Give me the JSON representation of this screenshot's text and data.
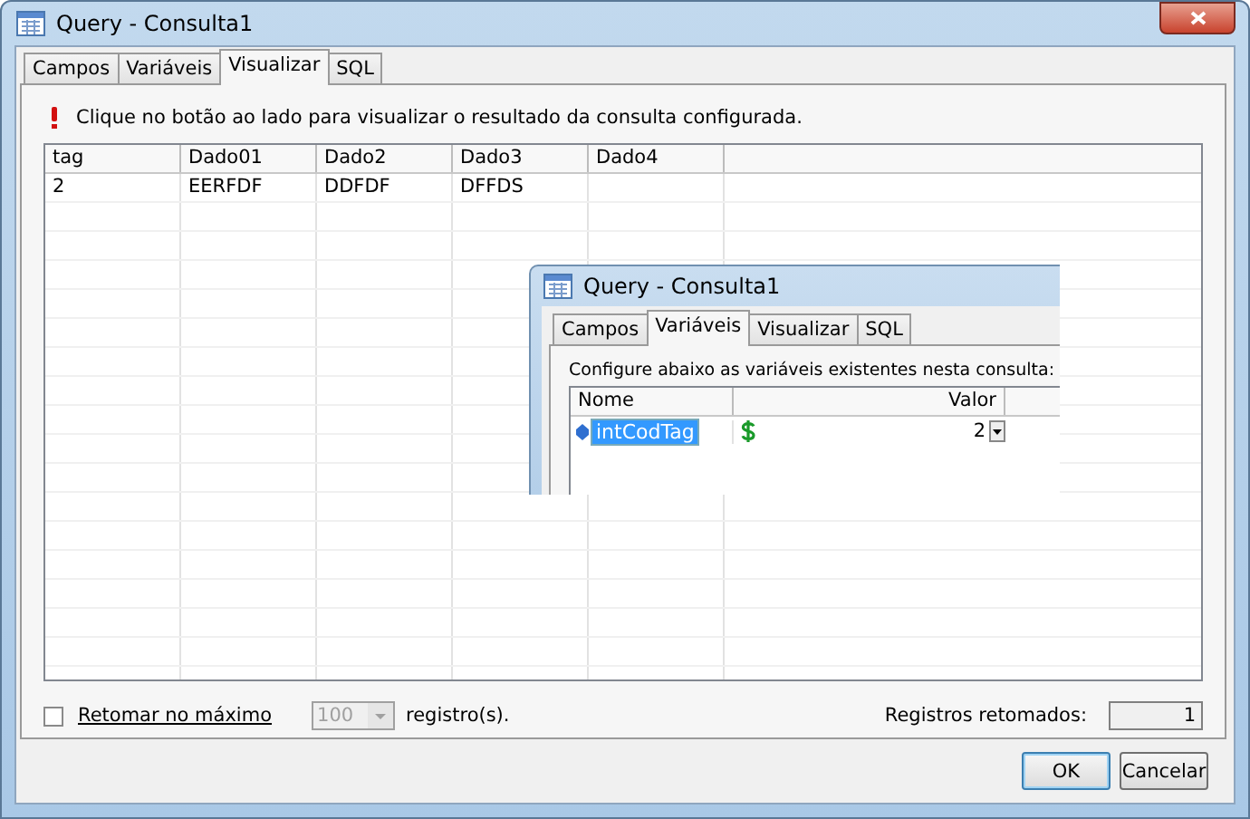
{
  "window": {
    "title": "Query - Consulta1"
  },
  "tabs": [
    {
      "label": "Campos",
      "selected": false
    },
    {
      "label": "Variáveis",
      "selected": false
    },
    {
      "label": "Visualizar",
      "selected": true
    },
    {
      "label": "SQL",
      "selected": false
    }
  ],
  "message": "Clique no botão ao lado para visualizar o resultado da consulta configurada.",
  "table": {
    "columns": [
      "tag",
      "Dado01",
      "Dado2",
      "Dado3",
      "Dado4"
    ],
    "rows": [
      [
        "2",
        "EERFDF",
        "DDFDF",
        "DFFDS"
      ]
    ]
  },
  "embedded_window": {
    "title": "Query - Consulta1",
    "tabs": [
      {
        "label": "Campos",
        "selected": false
      },
      {
        "label": "Variáveis",
        "selected": true
      },
      {
        "label": "Visualizar",
        "selected": false
      },
      {
        "label": "SQL",
        "selected": false
      }
    ],
    "message": "Configure abaixo as variáveis existentes nesta consulta:",
    "columns": [
      "Nome",
      "Valor"
    ],
    "rows": [
      {
        "name": "intCodTag",
        "value": "2",
        "selected": true
      }
    ]
  },
  "limit": {
    "checked": false,
    "label": "Retomar no máximo",
    "value": "100",
    "disabled": true,
    "suffix": "registro(s)."
  },
  "count": {
    "label": "Registros retomados:",
    "value": "1"
  },
  "buttons": [
    {
      "label": "OK",
      "default": true
    },
    {
      "label": "Cancelar",
      "default": false
    }
  ]
}
